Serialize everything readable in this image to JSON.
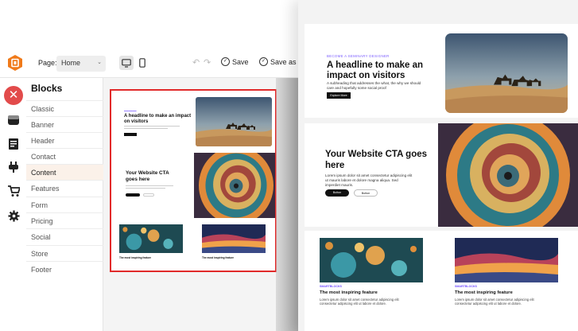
{
  "topbar": {
    "page_label": "Page:",
    "page_value": "Home",
    "save_label": "Save",
    "save_as_label": "Save as Te"
  },
  "icons": {
    "logo": "logo-icon",
    "close": "close-icon",
    "desktop": "desktop-icon",
    "mobile": "mobile-icon",
    "undo": "undo-icon",
    "redo": "redo-icon"
  },
  "sidebar": {
    "title": "Blocks",
    "items": [
      {
        "label": "Classic"
      },
      {
        "label": "Banner"
      },
      {
        "label": "Header"
      },
      {
        "label": "Contact"
      },
      {
        "label": "Content"
      },
      {
        "label": "Features"
      },
      {
        "label": "Form"
      },
      {
        "label": "Pricing"
      },
      {
        "label": "Social"
      },
      {
        "label": "Store"
      },
      {
        "label": "Footer"
      }
    ],
    "active_index": 4
  },
  "preview": {
    "hero_kicker": "",
    "hero_title": "A headline to make an impact on visitors",
    "cta_title": "Your Website CTA goes here",
    "feature_title": "The most inspiring feature"
  },
  "zoom": {
    "hero": {
      "kicker": "BECOME A SEMINARY DESIGNER",
      "title": "A headline to make an impact on visitors",
      "subtitle": "A subheading that addresses the what, the why we should care and hopefully some social proof",
      "button": "Explore More"
    },
    "cta": {
      "title": "Your Website CTA goes here",
      "subtitle": "Lorem ipsum dolor sit amet consectetur adipiscing elit ut mauris labore et dolore magna aliqua. Sed imperdiet mauris.",
      "primary_button": "Button",
      "secondary_button": "Button"
    },
    "features": [
      {
        "tag": "SMARTBLOCKS",
        "title": "The most inspiring feature",
        "desc": "Lorem ipsum dolor sit amet consectetur adipiscing elit consectetur adipiscing elit ut labore et dolore."
      },
      {
        "tag": "SMARTBLOCKS",
        "title": "The most inspiring feature",
        "desc": "Lorem ipsum dolor sit amet consectetur adipiscing elit consectetur adipiscing elit ut labore et dolore."
      }
    ]
  },
  "colors": {
    "accent": "#e24b4b",
    "highlight": "#e12a2a",
    "logo_orange": "#f07a1a",
    "tag_purple": "#6f4bff"
  }
}
